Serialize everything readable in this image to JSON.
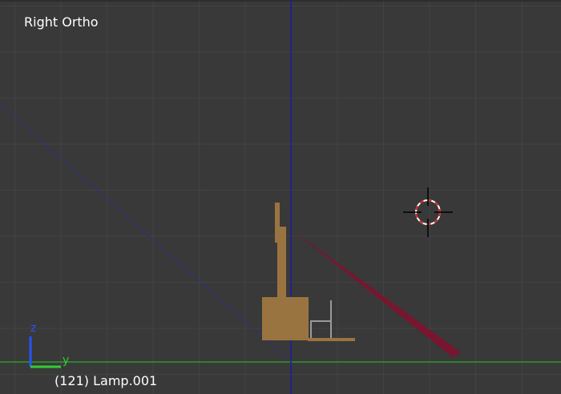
{
  "viewport": {
    "view_name": "Right Ortho",
    "active_object": "(121) Lamp.001",
    "colors": {
      "background": "#393939",
      "grid": "#434343",
      "z_axis": "#1a1aa8",
      "y_axis": "#2a9a2a",
      "object": "#9a7440",
      "lamp_direction": "#7a1530",
      "wire": "#9a9a9a"
    }
  },
  "axis_gizmo": {
    "z_label": "z",
    "y_label": "y"
  },
  "icons": {
    "cursor": "3d-cursor-icon",
    "gizmo": "axis-gizmo-icon"
  }
}
